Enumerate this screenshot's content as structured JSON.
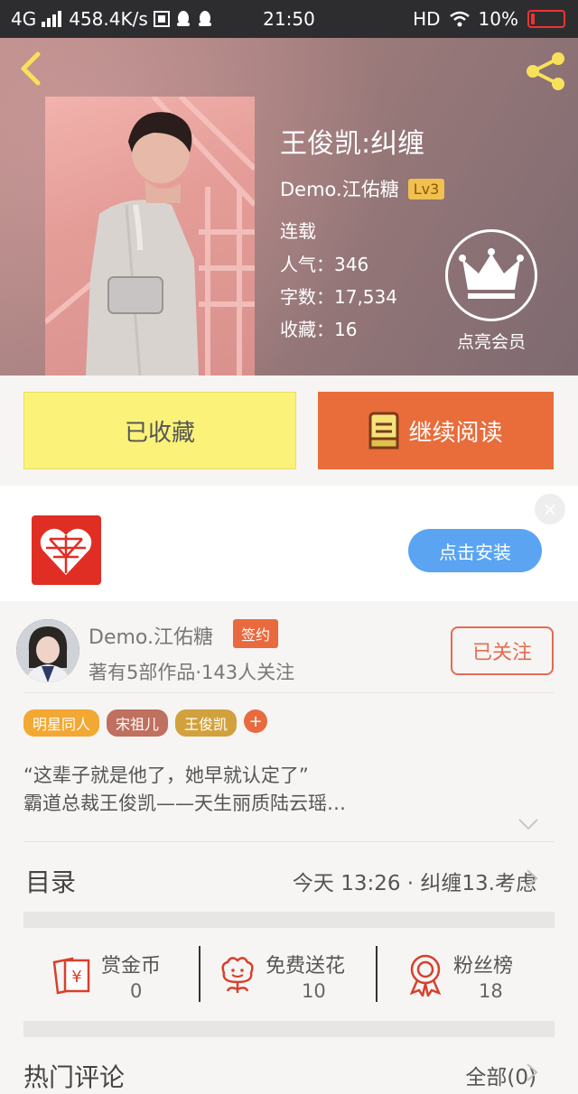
{
  "status_bar": {
    "network": "4G",
    "speed": "458.4K/s",
    "time": "21:50",
    "hd": "HD",
    "battery": "10%"
  },
  "book": {
    "title": "王俊凯:纠缠",
    "author": "Demo.江佑糖",
    "level": "Lv3",
    "status": "连载",
    "popularity": "人气：346",
    "words": "字数：17,534",
    "favorites": "收藏：16",
    "vip_label": "点亮会员"
  },
  "actions": {
    "favorited_label": "已收藏",
    "continue_label": "继续阅读"
  },
  "ad": {
    "install_label": "点击安装",
    "close_symbol": "×"
  },
  "author_card": {
    "name": "Demo.江佑糖",
    "signed_badge": "签约",
    "subtitle": "著有5部作品·143人关注",
    "follow_label": "已关注",
    "tags": [
      {
        "label": "明星同人",
        "color": "#f2a832"
      },
      {
        "label": "宋祖儿",
        "color": "#c0705e"
      },
      {
        "label": "王俊凯",
        "color": "#d1a13e"
      }
    ],
    "tag_plus": "+",
    "intro_line1": "“这辈子就是他了，她早就认定了”",
    "intro_line2": "霸道总裁王俊凯——天生丽质陆云瑶…"
  },
  "toc": {
    "title": "目录",
    "latest": "今天 13:26 · 纠缠13.考虑"
  },
  "stats": [
    {
      "label": "赏金币",
      "value": "0",
      "icon": "coin-envelope-icon"
    },
    {
      "label": "免费送花",
      "value": "10",
      "icon": "flower-icon"
    },
    {
      "label": "粉丝榜",
      "value": "18",
      "icon": "medal-icon"
    }
  ],
  "comments": {
    "title": "热门评论",
    "all_label": "全部(0)"
  },
  "colors": {
    "accent_orange": "#e96c3b",
    "favorite_yellow": "#fbf27a",
    "install_blue": "#5aa4f2",
    "icon_red": "#d8402c"
  }
}
